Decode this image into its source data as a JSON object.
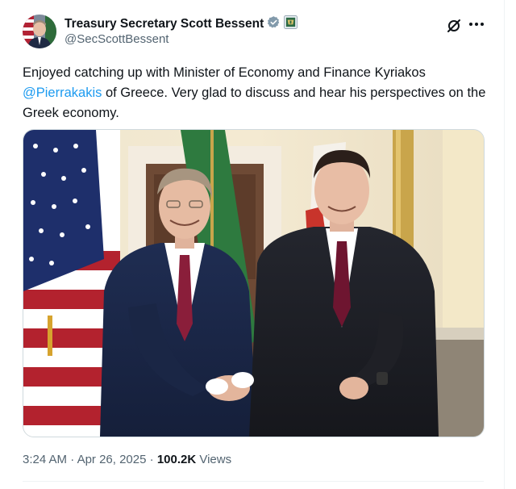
{
  "author": {
    "name": "Treasury Secretary Scott Bessent",
    "handle": "@SecScottBessent",
    "verified_badge": "gray-check-badge-icon",
    "affiliate_badge": "treasury-seal-icon"
  },
  "header_actions": {
    "grok_icon": "grok-icon",
    "more_icon": "more-dots-icon"
  },
  "tweet": {
    "text_before": "Enjoyed catching up with Minister of Economy and Finance Kyriakos ",
    "mention": "@Pierrakakis",
    "text_after": " of Greece. Very glad to discuss and hear his perspectives on the Greek economy."
  },
  "meta": {
    "time": "3:24 AM",
    "sep1": "·",
    "date": "Apr 26, 2025",
    "sep2": "·",
    "views_count": "100.2K",
    "views_label": "Views"
  },
  "colors": {
    "link": "#1d9bf0",
    "secondary_text": "#536471",
    "primary_text": "#0f1419",
    "border": "#cfd9de"
  }
}
